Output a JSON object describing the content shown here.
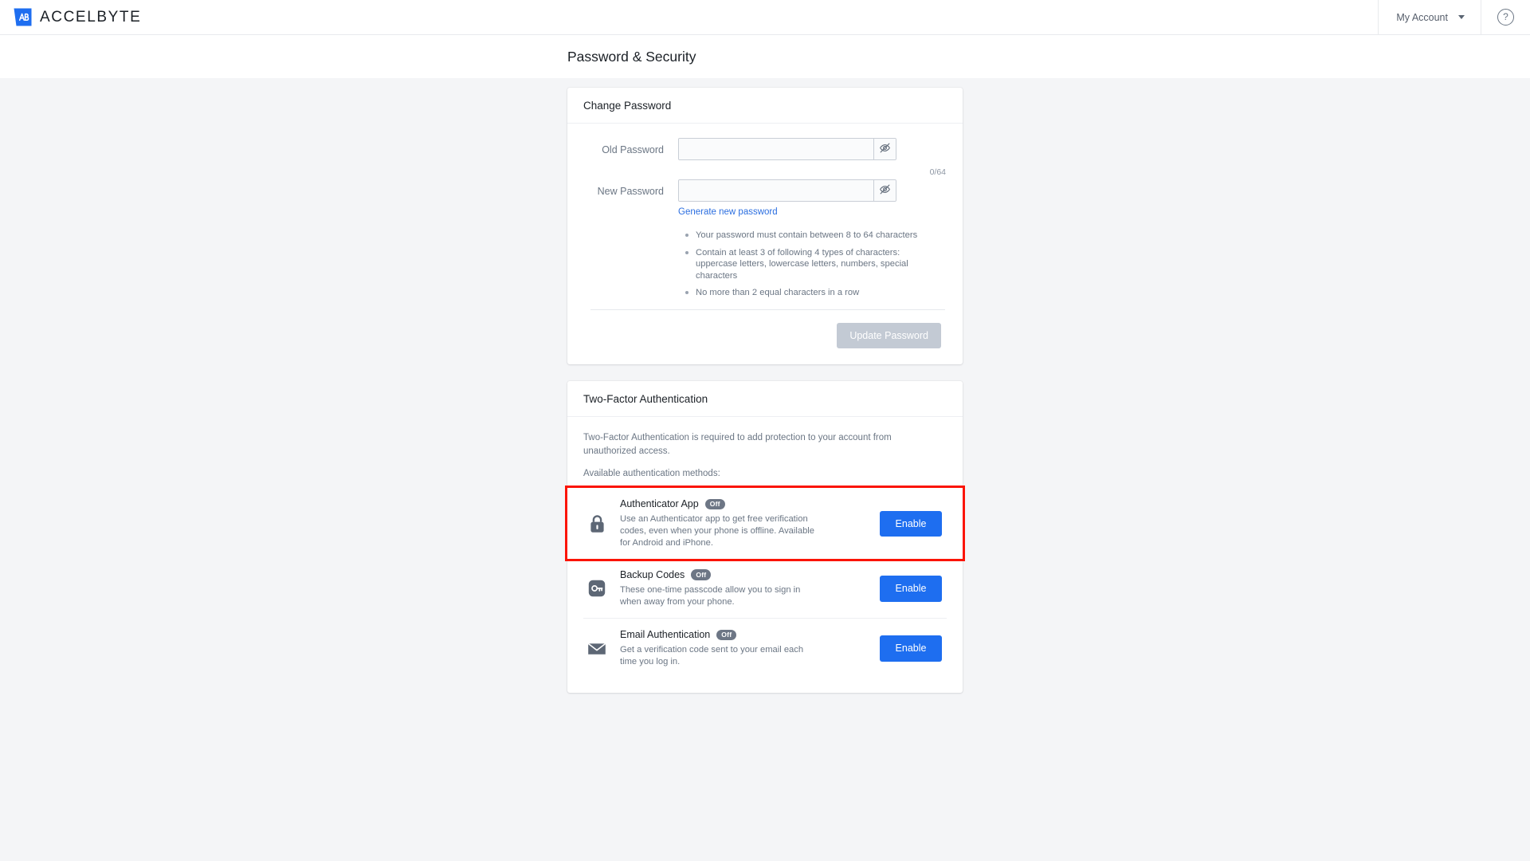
{
  "topbar": {
    "logo_icon": "accelbyte-logo-icon",
    "brand_name": "ACCELBYTE",
    "account_label": "My Account",
    "caret_icon": "chevron-down-icon",
    "help_icon": "help-circle-icon",
    "help_glyph": "?"
  },
  "page": {
    "title": "Password & Security"
  },
  "change_password": {
    "card_title": "Change Password",
    "old_password": {
      "label": "Old Password",
      "value": "",
      "placeholder": "",
      "toggle_icon": "eye-off-icon"
    },
    "new_password": {
      "label": "New Password",
      "value": "",
      "placeholder": "",
      "counter": "0/64",
      "toggle_icon": "eye-off-icon",
      "generate_link": "Generate new password"
    },
    "rules": [
      "Your password must contain between 8 to 64 characters",
      "Contain at least 3 of following 4 types of characters: uppercase letters, lowercase letters, numbers, special characters",
      "No more than 2 equal characters in a row"
    ],
    "submit_label": "Update Password",
    "submit_disabled": true
  },
  "two_factor": {
    "card_title": "Two-Factor Authentication",
    "intro": "Two-Factor Authentication is required to add protection to your account from unauthorized access.",
    "subheading": "Available authentication methods:",
    "methods": [
      {
        "icon": "lock-icon",
        "title": "Authenticator App",
        "status": "Off",
        "description": "Use an Authenticator app to get free verification codes, even when your phone is offline. Available for Android and iPhone.",
        "action_label": "Enable",
        "highlighted": true
      },
      {
        "icon": "key-icon",
        "title": "Backup Codes",
        "status": "Off",
        "description": "These one-time passcode allow you to sign in when away from your phone.",
        "action_label": "Enable",
        "highlighted": false
      },
      {
        "icon": "mail-icon",
        "title": "Email Authentication",
        "status": "Off",
        "description": "Get a verification code sent to your email each time you log in.",
        "action_label": "Enable",
        "highlighted": false
      }
    ]
  },
  "colors": {
    "brand_blue": "#1e6ef0",
    "page_bg": "#f4f5f7",
    "highlight_red": "#fb1405",
    "badge_gray": "#6d7685",
    "disabled_gray": "#c3cad4"
  }
}
